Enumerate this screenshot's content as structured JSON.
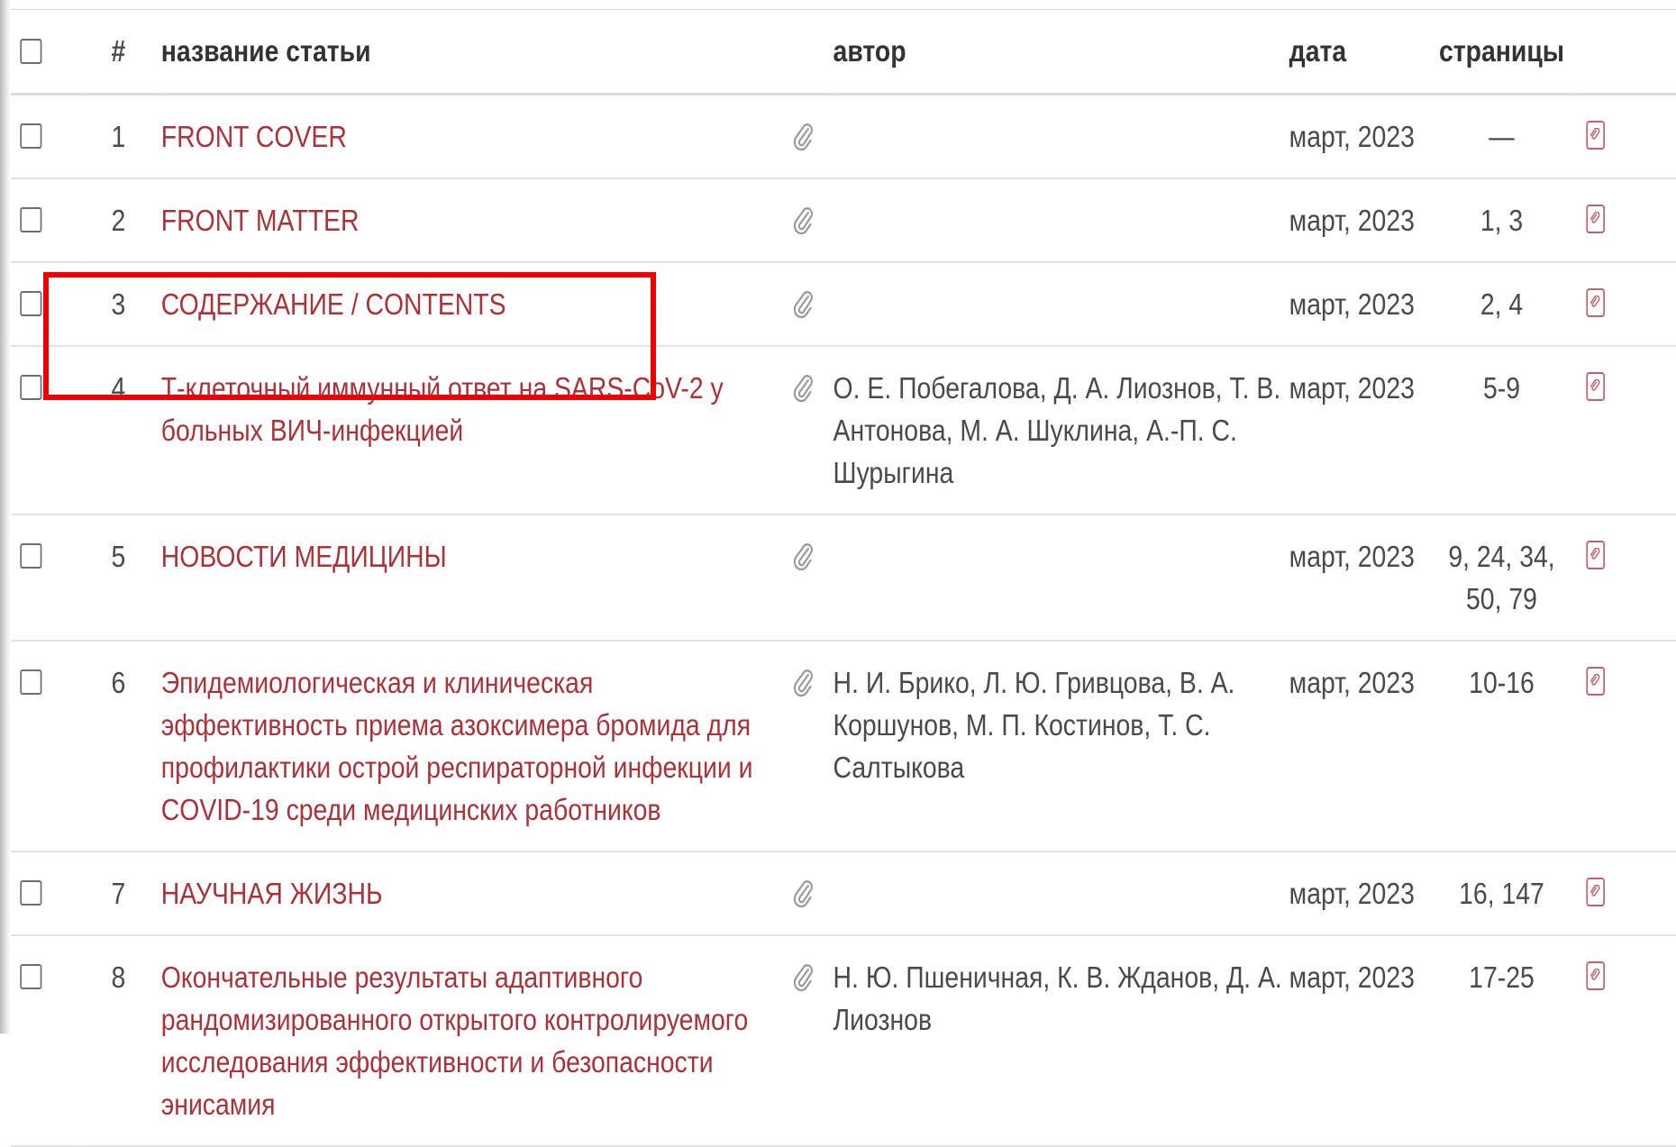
{
  "columns": {
    "num": "#",
    "title": "название статьи",
    "author": "автор",
    "date": "дата",
    "pages": "страницы"
  },
  "icons": {
    "attachment": "paperclip-icon",
    "link": "link-icon"
  },
  "colors": {
    "title_link": "#a8333a",
    "highlight": "#ee0000"
  },
  "rows": [
    {
      "num": "1",
      "title": "FRONT COVER",
      "author": "",
      "date": "март, 2023",
      "pages": "—"
    },
    {
      "num": "2",
      "title": "FRONT MATTER",
      "author": "",
      "date": "март, 2023",
      "pages": "1, 3"
    },
    {
      "num": "3",
      "title": "СОДЕРЖАНИЕ / CONTENTS",
      "author": "",
      "date": "март, 2023",
      "pages": "2, 4"
    },
    {
      "num": "4",
      "title": "Т-клеточный иммунный ответ на SARS-CoV-2 у больных ВИЧ-инфекцией",
      "author": "О. Е. Побегалова, Д. А. Лиознов, Т. В. Антонова, М. А. Шуклина, А.-П. С. Шурыгина",
      "date": "март, 2023",
      "pages": "5-9"
    },
    {
      "num": "5",
      "title": "НОВОСТИ МЕДИЦИНЫ",
      "author": "",
      "date": "март, 2023",
      "pages": "9, 24, 34, 50, 79"
    },
    {
      "num": "6",
      "title": "Эпидемиологическая и клиническая эффективность приема азоксимера бромида для профилактики острой респираторной инфекции и COVID-19 среди медицинских работников",
      "author": "Н. И. Брико, Л. Ю. Гривцова, В. А. Коршунов, М. П. Костинов, Т. С. Салтыкова",
      "date": "март, 2023",
      "pages": "10-16"
    },
    {
      "num": "7",
      "title": "НАУЧНАЯ ЖИЗНЬ",
      "author": "",
      "date": "март, 2023",
      "pages": "16, 147"
    },
    {
      "num": "8",
      "title": "Окончательные результаты адаптивного рандомизированного открытого контролируемого исследования эффективности и безопасности энисамия",
      "author": "Н. Ю. Пшеничная, К. В. Жданов, Д. А. Лиознов",
      "date": "март, 2023",
      "pages": "17-25"
    }
  ]
}
